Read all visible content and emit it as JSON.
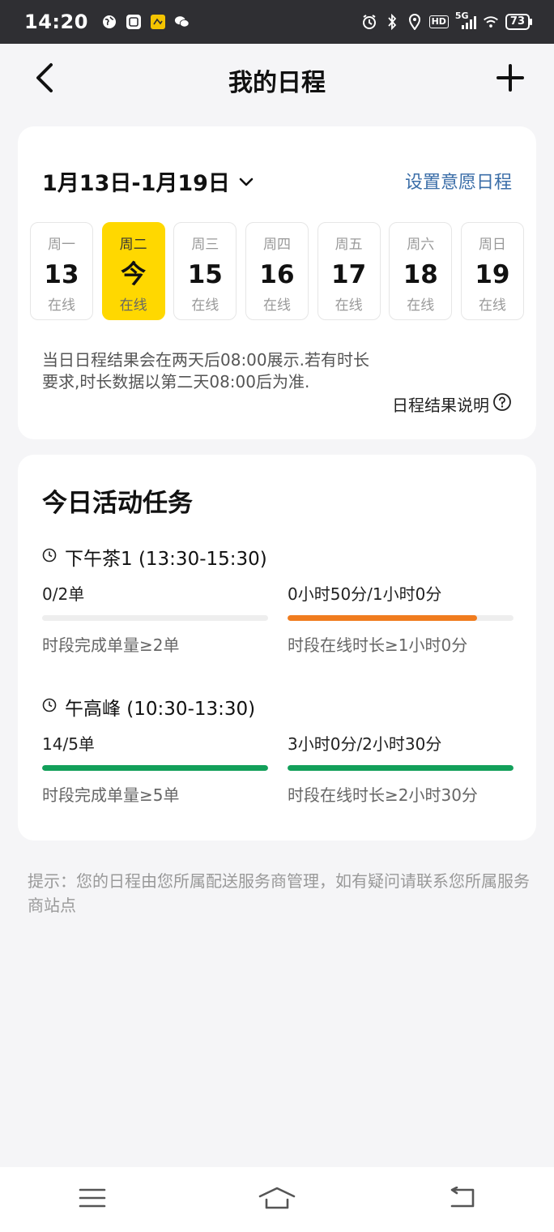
{
  "status_bar": {
    "time": "14:20",
    "network": "5G",
    "hd": "HD",
    "battery": "73",
    "left_icons": [
      "globe-icon",
      "app-icon",
      "app-icon",
      "wechat-icon"
    ],
    "right_icons": [
      "alarm-icon",
      "bluetooth-icon",
      "location-icon",
      "hd-icon",
      "signal-icon",
      "wifi-icon",
      "battery-icon"
    ]
  },
  "header": {
    "title": "我的日程",
    "back_icon": "chevron-left-icon",
    "add_icon": "plus-icon"
  },
  "schedule": {
    "week_range": "1月13日-1月19日",
    "set_link": "设置意愿日程",
    "days": [
      {
        "weekday": "周一",
        "num": "13",
        "status": "在线",
        "active": false
      },
      {
        "weekday": "周二",
        "num": "今",
        "status": "在线",
        "active": true
      },
      {
        "weekday": "周三",
        "num": "15",
        "status": "在线",
        "active": false
      },
      {
        "weekday": "周四",
        "num": "16",
        "status": "在线",
        "active": false
      },
      {
        "weekday": "周五",
        "num": "17",
        "status": "在线",
        "active": false
      },
      {
        "weekday": "周六",
        "num": "18",
        "status": "在线",
        "active": false
      },
      {
        "weekday": "周日",
        "num": "19",
        "status": "在线",
        "active": false
      }
    ],
    "note": "当日日程结果会在两天后08:00展示.若有时长要求,时长数据以第二天08:00后为准.",
    "result_link": "日程结果说明"
  },
  "tasks": {
    "title": "今日活动任务",
    "items": [
      {
        "name": "下午茶1 (13:30-15:30)",
        "orders": {
          "value": "0/2单",
          "progress": 0,
          "requirement": "时段完成单量≥2单"
        },
        "duration": {
          "value": "0小时50分/1小时0分",
          "progress": 0.84,
          "requirement": "时段在线时长≥1小时0分"
        }
      },
      {
        "name": "午高峰 (10:30-13:30)",
        "orders": {
          "value": "14/5单",
          "progress": 1,
          "requirement": "时段完成单量≥5单"
        },
        "duration": {
          "value": "3小时0分/2小时30分",
          "progress": 1,
          "requirement": "时段在线时长≥2小时30分"
        }
      }
    ]
  },
  "footer_tip": "提示：您的日程由您所属配送服务商管理，如有疑问请联系您所属服务商站点",
  "colors": {
    "accent_yellow": "#ffd800",
    "link_blue": "#3b6ea8",
    "progress_orange": "#f07c1e",
    "progress_green": "#12a05a",
    "progress_track": "#eeeeee"
  },
  "nav": {
    "icons": [
      "menu-icon",
      "home-icon",
      "back-icon"
    ]
  }
}
